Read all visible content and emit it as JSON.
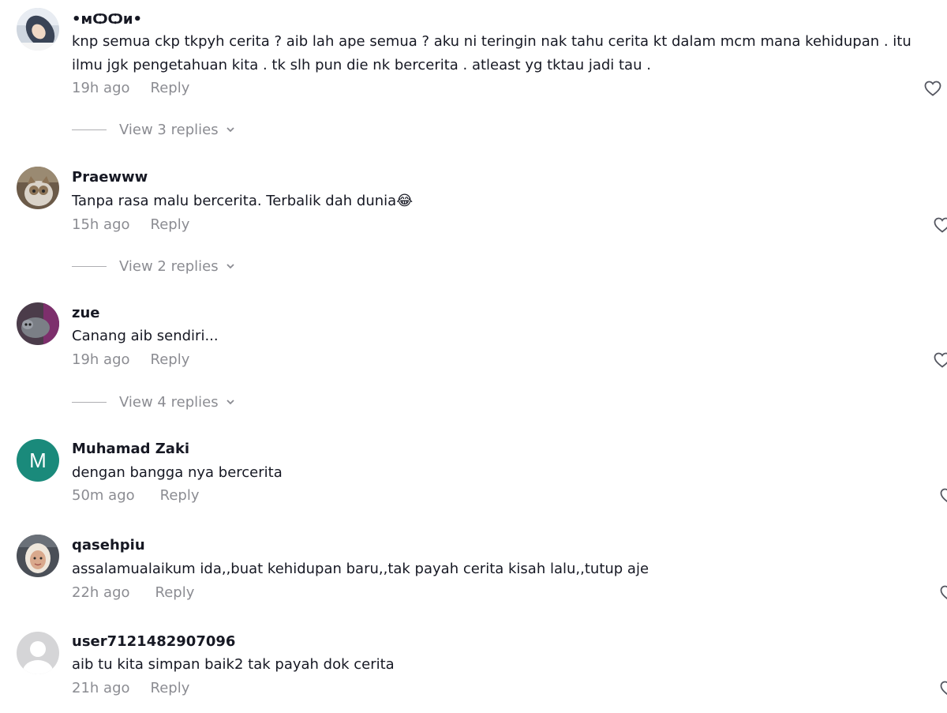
{
  "colors": {
    "letter_avatar_bg": "#1a8a7b"
  },
  "comments": [
    {
      "username": "•ᴍѺѺᴎ•",
      "text": "knp semua ckp tkpyh cerita ? aib lah ape semua ? aku ni teringin nak tahu cerita kt dalam mcm mana kehidupan . itu ilmu jgk pengetahuan kita . tk slh pun die nk bercerita . atleast yg tktau jadi tau .",
      "time": "19h ago",
      "reply": "Reply",
      "view_replies": "View 3 replies"
    },
    {
      "username": "Praewww",
      "text": "Tanpa rasa malu bercerita. Terbalik dah dunia😂",
      "time": "15h ago",
      "reply": "Reply",
      "view_replies": "View 2 replies"
    },
    {
      "username": "zue",
      "text": "Canang aib sendiri...",
      "time": "19h ago",
      "reply": "Reply",
      "view_replies": "View 4 replies"
    },
    {
      "username": "Muhamad Zaki",
      "avatar_letter": "M",
      "text": "dengan bangga nya bercerita",
      "time": "50m ago",
      "reply": "Reply"
    },
    {
      "username": "qasehpiu",
      "text": "assalamualaikum ida,,buat kehidupan baru,,tak payah cerita kisah lalu,,tutup aje",
      "time": "22h ago",
      "reply": "Reply"
    },
    {
      "username": "user7121482907096",
      "text": "aib tu kita simpan baik2 tak payah dok cerita",
      "time": "21h ago",
      "reply": "Reply"
    }
  ]
}
